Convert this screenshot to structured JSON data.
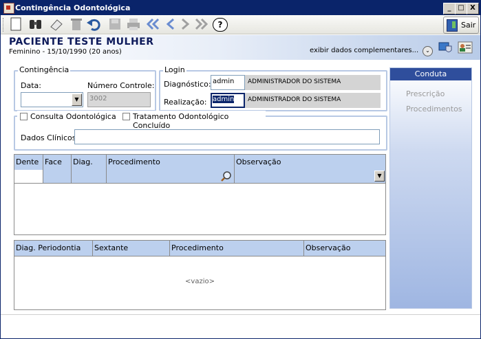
{
  "window": {
    "title": "Contingência Odontológica",
    "minimize": "_",
    "maximize": "□",
    "close": "X"
  },
  "toolbar": {
    "sair_label": "Sair",
    "help": "?"
  },
  "patient": {
    "name": "PACIENTE TESTE MULHER",
    "info": "Feminino - 15/10/1990 (20 anos)"
  },
  "header": {
    "exibir": "exibir dados complementares...",
    "chev": "⌄"
  },
  "contingencia": {
    "legend": "Contingência",
    "data_label": "Data:",
    "data_value": "",
    "controle_label": "Número Controle:",
    "controle_value": "3002"
  },
  "login": {
    "legend": "Login",
    "diag_label": "Diagnóstico:",
    "diag_user": "admin",
    "diag_name": "ADMINISTRADOR DO SISTEMA",
    "real_label": "Realização:",
    "real_user": "admin",
    "real_name": "ADMINISTRADOR DO SISTEMA"
  },
  "clinico": {
    "consulta": "Consulta Odontológica",
    "tratamento": "Tratamento Odontológico Concluído",
    "dados_label": "Dados Clínicos:",
    "dados_value": ""
  },
  "grid1": {
    "columns": [
      "Dente",
      "Face",
      "Diag.",
      "Procedimento",
      "Observação"
    ]
  },
  "grid2": {
    "columns": [
      "Diag. Periodontia",
      "Sextante",
      "Procedimento",
      "Observação"
    ],
    "empty": "<vazio>"
  },
  "side": {
    "header": "Conduta",
    "items": [
      "Prescrição",
      "Procedimentos"
    ]
  }
}
